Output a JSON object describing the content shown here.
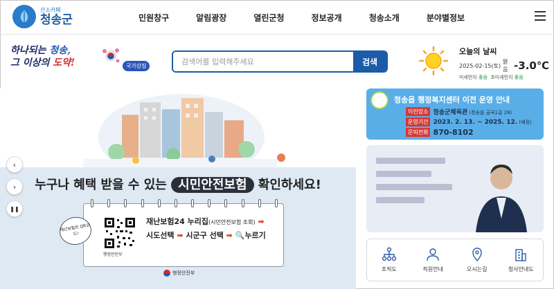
{
  "header": {
    "logo_small": "산소카페",
    "logo_big": "청송군",
    "nav": [
      "민원창구",
      "알림광장",
      "열린군청",
      "정보공개",
      "청송소개",
      "분야별정보"
    ]
  },
  "slogan": {
    "line1_a": "하나되는 ",
    "line1_b": "청송,",
    "line2_a": "그 이상의 ",
    "line2_b": "도약!",
    "badge": "국가상징"
  },
  "search": {
    "placeholder": "검색어를 입력해주세요",
    "button": "검색"
  },
  "weather": {
    "title": "오늘의 날씨",
    "date": "2025-02-15(토)",
    "condition": "맑음",
    "temp": "-3.0℃",
    "dust_label": "미세먼지",
    "dust_value": "좋음",
    "ultra_label": "초미세먼지",
    "ultra_value": "좋음"
  },
  "banner": {
    "headline_pre": "누구나 혜택 받을 수 있는 ",
    "headline_pill": "시민안전보험",
    "headline_post": " 확인하세요!",
    "line1": "재난보험24 누리집",
    "line1_small": "(시민안전보험 조회)",
    "line2a": "시도선택",
    "line2b": "시군구 선택",
    "line2c": "누르기",
    "sticker": "재난보험은 QR코드!",
    "qr_label": "행정안전부",
    "footer": "행정안전부",
    "arrow": "➡",
    "search_glyph": "🔍"
  },
  "controls": {
    "prev": "‹",
    "next": "›",
    "pause": "❚❚"
  },
  "notice": {
    "title": "청송읍 행정복지센터 이전 운영 안내",
    "rows": [
      {
        "key": "이전장소",
        "val": "청송군체육관",
        "small": " (청송읍 금곡1길 28)"
      },
      {
        "key": "운영기간",
        "val": "2023. 2. 13. ~ 2025. 12.",
        "small": " (예정)"
      },
      {
        "key": "문의전화",
        "val": "870-8102",
        "small": ""
      }
    ]
  },
  "quick": [
    "조직도",
    "직원안내",
    "오시는길",
    "청사안내도"
  ],
  "colors": {
    "brand": "#1b5ba8",
    "notice_bg": "#5aaee8",
    "accent_red": "#d5262a"
  }
}
